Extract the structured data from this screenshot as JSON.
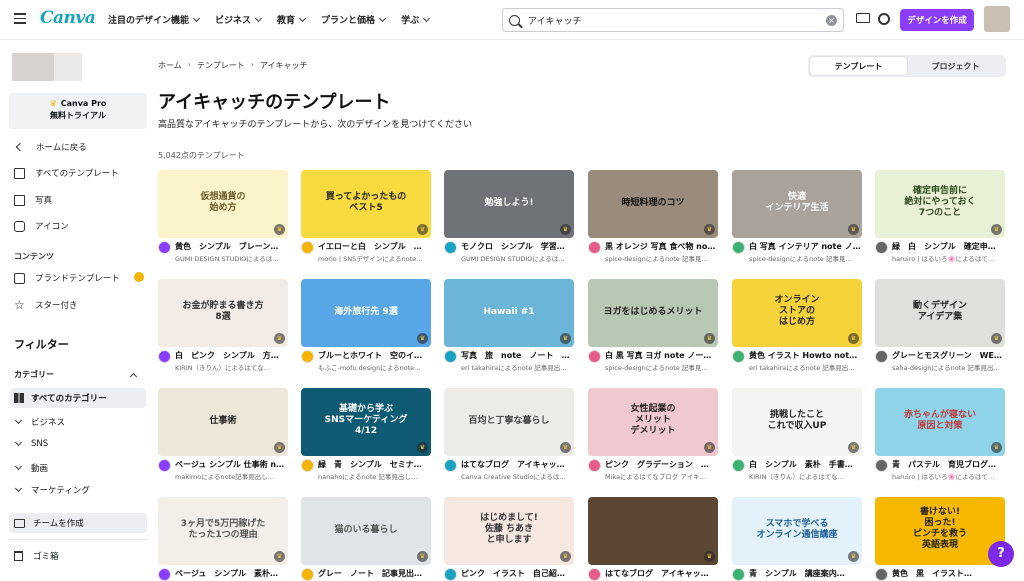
{
  "topbar": {
    "logo": "Canva",
    "nav": [
      "注目のデザイン機能",
      "ビジネス",
      "教育",
      "プランと価格",
      "学ぶ"
    ],
    "search_value": "アイキャッチ",
    "create_label": "デザインを作成"
  },
  "sidebar": {
    "pro_line1": "Canva Pro",
    "pro_line2": "無料トライアル",
    "items": [
      "ホームに戻る",
      "すべてのテンプレート",
      "写真",
      "アイコン"
    ],
    "contents_label": "コンテンツ",
    "brand_label": "ブランドテンプレート",
    "starred_label": "スター付き",
    "filter_label": "フィルター",
    "category_label": "カテゴリー",
    "categories": [
      "すべてのカテゴリー",
      "ビジネス",
      "SNS",
      "動画",
      "マーケティング"
    ],
    "team_label": "チームを作成",
    "trash_label": "ゴミ箱"
  },
  "main": {
    "breadcrumb": [
      "ホーム",
      "テンプレート",
      "アイキャッチ"
    ],
    "tabs": [
      "テンプレート",
      "プロジェクト"
    ],
    "title": "アイキャッチのテンプレート",
    "subtitle": "高品質なアイキャッチのテンプレートから、次のデザインを見つけてください",
    "count": "5,042点のテンプレート"
  },
  "cards": [
    {
      "thumb": "仮想通貨の\n始め方",
      "title": "黄色　シンプル　ブレーン…",
      "author": "GUMI DESIGN STUDIOによるは…",
      "bg": "#fbf3c9",
      "fg": "#6b5a2a"
    },
    {
      "thumb": "買ってよかったもの\nベスト5",
      "title": "イエローと白　シンプル　…",
      "author": "morio | SNSデザインによるnote…",
      "bg": "#f7d940",
      "fg": "#222"
    },
    {
      "thumb": "勉強しよう!",
      "title": "モノクロ　シンプル　学習…",
      "author": "GUMI DESIGN STUDIOによるは…",
      "bg": "#6f7377",
      "fg": "#fff"
    },
    {
      "thumb": "時短料理のコツ",
      "title": "黒 オレンジ 写真 食べ物 note…",
      "author": "spice-designによるnote 記事見…",
      "bg": "#9a8c7d",
      "fg": "#111"
    },
    {
      "thumb": "快適\nインテリア生活",
      "title": "白 写真 インテリア note ノ…",
      "author": "spice-designによるnote 記事見…",
      "bg": "#a9a39b",
      "fg": "#fff"
    },
    {
      "thumb": "確定申告前に\n絶対にやっておく\n7つのこと",
      "title": "緑　白　シンプル　確定申…",
      "author": "haruiro | はるいろ🌸によるはて…",
      "bg": "#e8f0d6",
      "fg": "#2d4a1d"
    },
    {
      "thumb": "お金が貯まる書き方\n8選",
      "title": "白　ピンク　シンプル　方…",
      "author": "KIRIN（きりん）によるはてな…",
      "bg": "#f3ece6",
      "fg": "#333"
    },
    {
      "thumb": "海外旅行先 9選",
      "title": "ブルーとホワイト　空のイ…",
      "author": "もふこ-mofu designによるnote…",
      "bg": "#59a6e6",
      "fg": "#fff"
    },
    {
      "thumb": "Hawaii #1",
      "title": "写真　旅　note　ノート　…",
      "author": "eri takahiraによるnote 記事見出…",
      "bg": "#6bb6d8",
      "fg": "#fff"
    },
    {
      "thumb": "ヨガをはじめるメリット",
      "title": "白 黒 写真 ヨガ note ノート…",
      "author": "spice-designによるnote 記事見…",
      "bg": "#b9c7b5",
      "fg": "#222"
    },
    {
      "thumb": "オンライン\nストアの\nはじめ方",
      "title": "黄色 イラスト Howto note …",
      "author": "eri takahiraによるnote 記事見出…",
      "bg": "#f5d23a",
      "fg": "#222"
    },
    {
      "thumb": "動くデザイン\nアイデア集",
      "title": "グレーとモスグリーン　WE…",
      "author": "saha-designによるnote 記事見出…",
      "bg": "#dfdfdc",
      "fg": "#222"
    },
    {
      "thumb": "仕事術",
      "title": "ベージュ シンプル 仕事術 n…",
      "author": "makimoによるnote記事見出し…",
      "bg": "#efe6da",
      "fg": "#222"
    },
    {
      "thumb": "基礎から学ぶ\nSNSマーケティング\n4/12",
      "title": "緑　青　シンプル　セミナ…",
      "author": "nanahoによるnote 記事見出し…",
      "bg": "#0f5a73",
      "fg": "#fff"
    },
    {
      "thumb": "百均と丁寧な暮らし",
      "title": "はてなブログ　アイキャッ…",
      "author": "Canva Creative Studioによるは…",
      "bg": "#ecebe8",
      "fg": "#444"
    },
    {
      "thumb": "女性起業の\nメリット\nデメリット",
      "title": "ピンク　グラデーション　…",
      "author": "Mikaによるはてなブログ アイキ…",
      "bg": "#f0c9d0",
      "fg": "#222"
    },
    {
      "thumb": "挑戦したこと\nこれで収入UP",
      "title": "白　シンプル　素朴　手書…",
      "author": "KIRIN（きりん）によるはてな…",
      "bg": "#f4f4f2",
      "fg": "#222"
    },
    {
      "thumb": "赤ちゃんが寝ない\n原因と対策",
      "title": "青　パステル　育児ブログ…",
      "author": "haruiro | はるいろ🌸によるはて…",
      "bg": "#8fd3e8",
      "fg": "#c13a3a"
    },
    {
      "thumb": "3ヶ月で5万円稼げた\nたった1つの理由",
      "title": "ベージュ　シンプル　素朴…",
      "author": "",
      "bg": "#f3efe8",
      "fg": "#555"
    },
    {
      "thumb": "猫のいる暮らし",
      "title": "グレー　ノート　記事見出…",
      "author": "",
      "bg": "#dfe4e6",
      "fg": "#555"
    },
    {
      "thumb": "はじめまして!\n佐藤 ちあき\nと申します",
      "title": "ピンク　イラスト　自己紹…",
      "author": "",
      "bg": "#f6e8e1",
      "fg": "#333"
    },
    {
      "thumb": "",
      "title": "はてなブログ　アイキャッ…",
      "author": "",
      "bg": "#5c4634",
      "fg": "#fff"
    },
    {
      "thumb": "スマホで学べる\nオンライン通信講座",
      "title": "青　シンプル　講座案内…",
      "author": "",
      "bg": "#e3f1fb",
      "fg": "#1d5f97"
    },
    {
      "thumb": "書けない!\n困った!\nピンチを救う\n英語表現",
      "title": "黄色　黒　イラスト…",
      "author": "",
      "bg": "#f6b800",
      "fg": "#222"
    }
  ],
  "help_label": "?"
}
